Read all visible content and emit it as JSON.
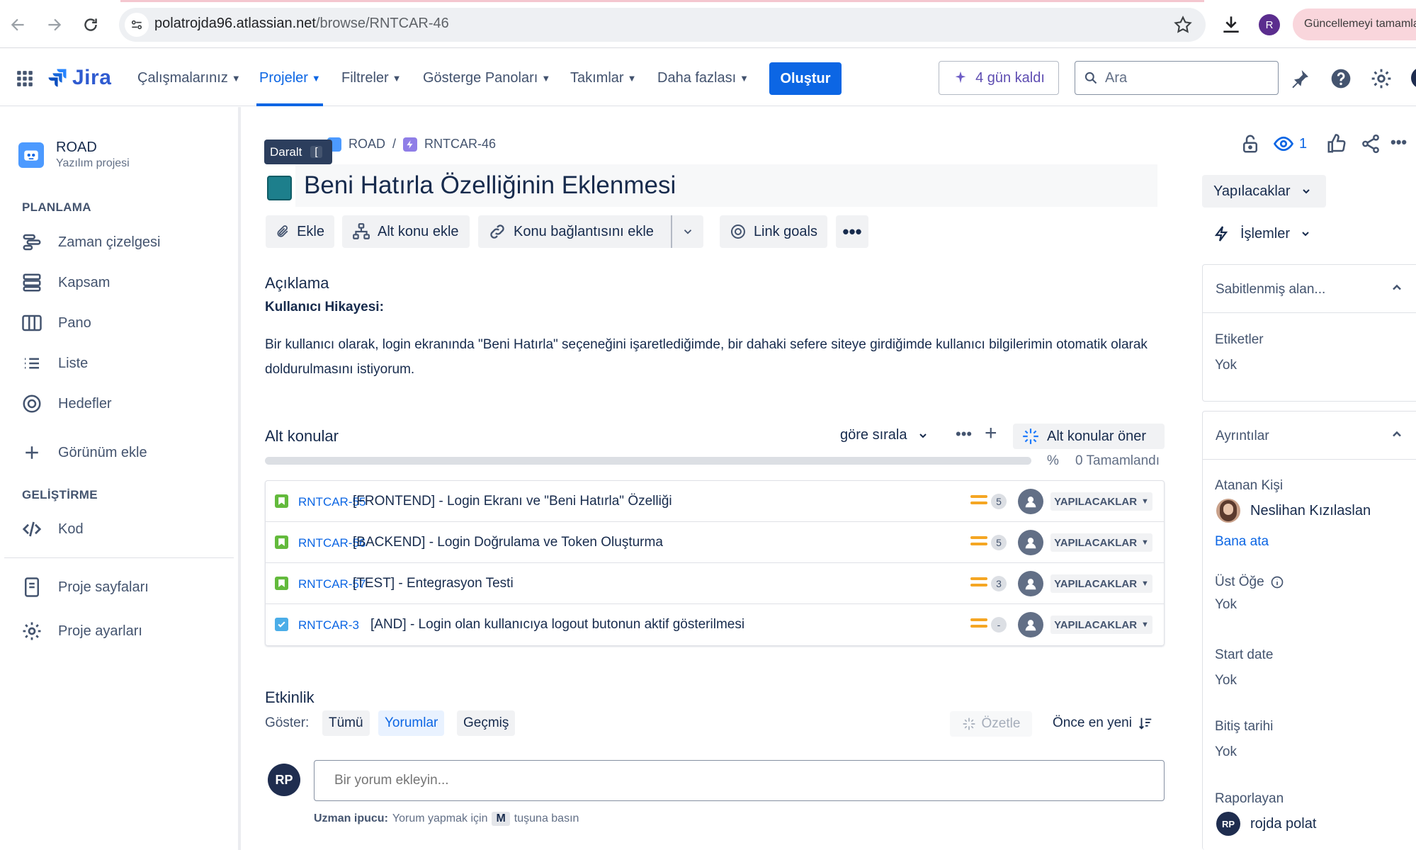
{
  "browser": {
    "url_host": "polatrojda96.atlassian.net",
    "url_path": "/browse/RNTCAR-46",
    "profile_initial": "R",
    "update_button": "Güncellemeyi tamamla"
  },
  "nav": {
    "logo_text": "Jira",
    "menu": [
      {
        "label": "Çalışmalarınız"
      },
      {
        "label": "Projeler"
      },
      {
        "label": "Filtreler"
      },
      {
        "label": "Gösterge Panoları"
      },
      {
        "label": "Takımlar"
      },
      {
        "label": "Daha fazlası"
      }
    ],
    "active_menu": "Projeler",
    "create_button": "Oluştur",
    "trial_button": "4 gün kaldı",
    "search_placeholder": "Ara",
    "brand_color": "#0c66e4"
  },
  "sidebar": {
    "project_name": "ROAD",
    "project_type": "Yazılım projesi",
    "planning_header": "PLANLAMA",
    "planning_items": [
      {
        "label": "Zaman çizelgesi",
        "icon": "timeline-icon"
      },
      {
        "label": "Kapsam",
        "icon": "backlog-icon"
      },
      {
        "label": "Pano",
        "icon": "board-icon"
      },
      {
        "label": "Liste",
        "icon": "list-icon"
      },
      {
        "label": "Hedefler",
        "icon": "goals-icon"
      }
    ],
    "add_view": "Görünüm ekle",
    "dev_header": "GELİŞTİRME",
    "code_item": "Kod",
    "project_pages": "Proje sayfaları",
    "project_settings": "Proje ayarları"
  },
  "issue": {
    "tooltip_label": "Daralt",
    "tooltip_key": "[",
    "breadcrumb_project": "ROAD",
    "breadcrumb_sep": "/",
    "breadcrumb_issue": "RNTCAR-46",
    "title": "Beni Hatırla Özelliğinin Eklenmesi",
    "toolbar": {
      "attach": "Ekle",
      "add_child": "Alt konu ekle",
      "add_link": "Konu bağlantısını ekle",
      "link_goals": "Link goals"
    },
    "description_header": "Açıklama",
    "story_label": "Kullanıcı Hikayesi:",
    "description": "Bir kullanıcı olarak, login ekranında \"Beni Hatırla\" seçeneğini işaretlediğimde, bir dahaki sefere siteye girdiğimde kullanıcı bilgilerimin otomatik olarak doldurulmasını istiyorum."
  },
  "subtasks": {
    "header": "Alt konular",
    "sort_label": "göre sırala",
    "suggest_button": "Alt konular öner",
    "progress_pct_label": "%",
    "progress_done_label": "0 Tamamlandı",
    "progress_fraction": 0,
    "rows": [
      {
        "key": "RNTCAR-55",
        "summary": "[FRONTEND] - Login Ekranı ve \"Beni Hatırla\" Özelliği",
        "points": "5",
        "status": "YAPILACAKLAR",
        "type": "story"
      },
      {
        "key": "RNTCAR-56",
        "summary": "[BACKEND] - Login Doğrulama ve Token Oluşturma",
        "points": "5",
        "status": "YAPILACAKLAR",
        "type": "story"
      },
      {
        "key": "RNTCAR-57",
        "summary": "[TEST] - Entegrasyon Testi",
        "points": "3",
        "status": "YAPILACAKLAR",
        "type": "story"
      },
      {
        "key": "RNTCAR-3",
        "summary": "[AND] - Login olan kullanıcıya logout butonun aktif gösterilmesi",
        "points": "-",
        "status": "YAPILACAKLAR",
        "type": "task"
      }
    ]
  },
  "activity": {
    "header": "Etkinlik",
    "show_label": "Göster:",
    "filters": [
      "Tümü",
      "Yorumlar",
      "Geçmiş"
    ],
    "selected_filter": "Yorumlar",
    "summarize": "Özetle",
    "sort": "Önce en yeni",
    "comment_avatar": "RP",
    "comment_placeholder": "Bir yorum ekleyin...",
    "tip_bold": "Uzman ipucu:",
    "tip_text": "Yorum yapmak için",
    "tip_key": "M",
    "tip_text2": "tuşuna basın"
  },
  "details": {
    "watchers": "1",
    "status_button": "Yapılacaklar",
    "actions_button": "İşlemler",
    "pinned_title": "Sabitlenmiş alan...",
    "labels_label": "Etiketler",
    "labels_value": "Yok",
    "details_title": "Ayrıntılar",
    "assignee_label": "Atanan Kişi",
    "assignee_name": "Neslihan Kızılaslan",
    "assign_to_me": "Bana ata",
    "parent_label": "Üst Öğe",
    "parent_value": "Yok",
    "start_label": "Start date",
    "start_value": "Yok",
    "due_label": "Bitiş tarihi",
    "due_value": "Yok",
    "reporter_label": "Raporlayan",
    "reporter_initials": "RP",
    "reporter_name": "rojda polat"
  }
}
